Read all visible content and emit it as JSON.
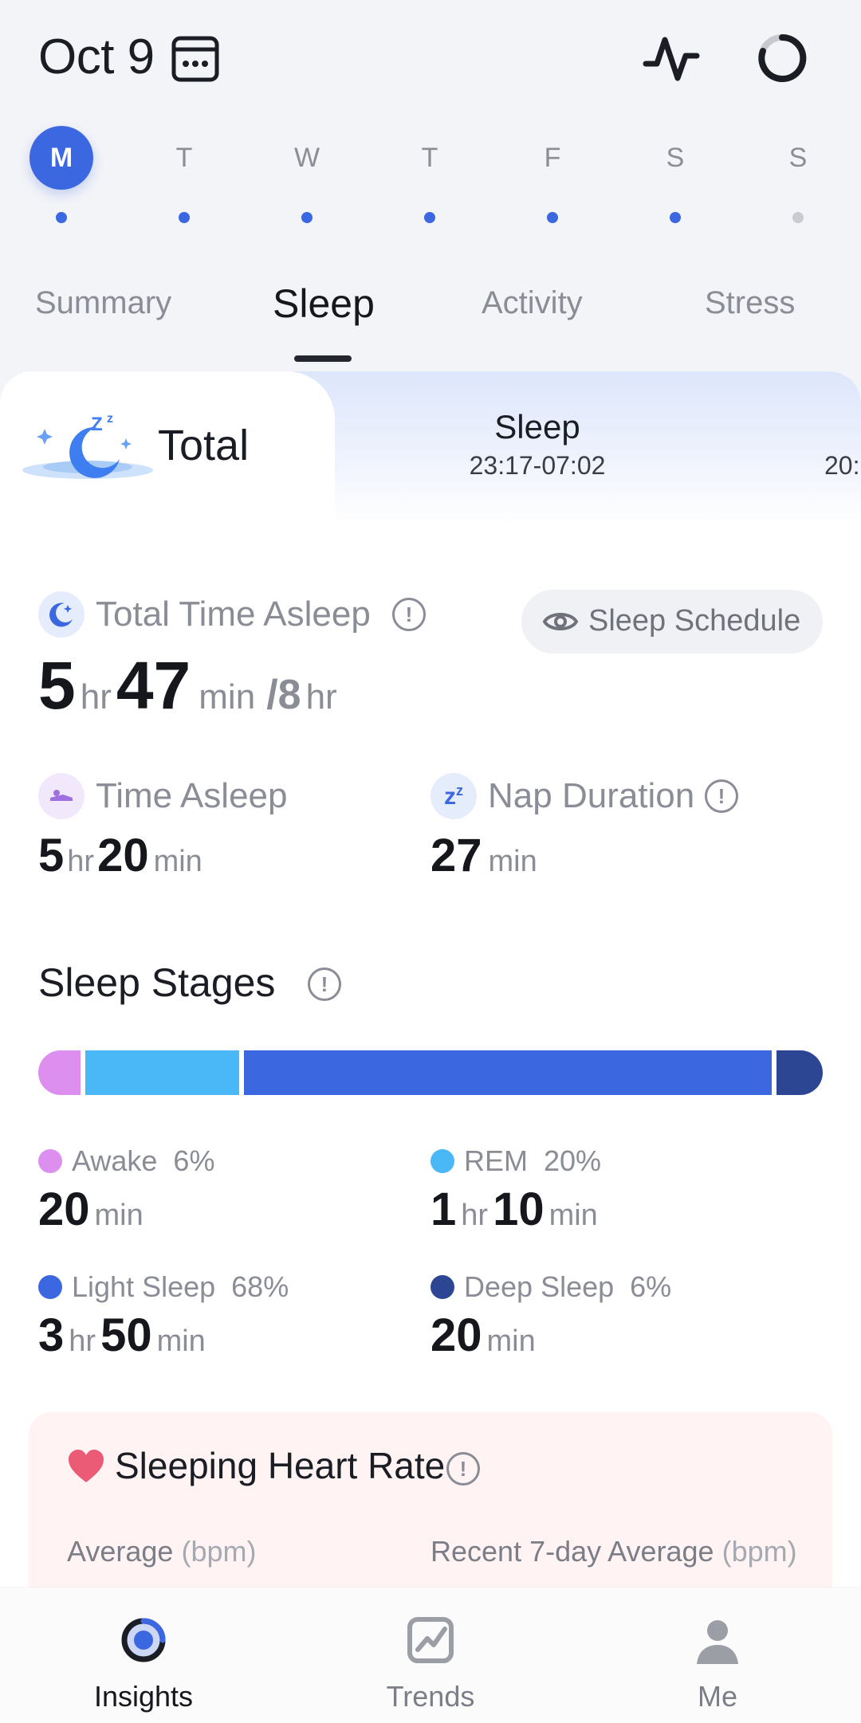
{
  "header": {
    "date": "Oct 9",
    "calendar_icon": "calendar-icon",
    "pulse_icon": "pulse-icon",
    "ring_icon": "ring-icon"
  },
  "week": {
    "days": [
      {
        "letter": "M",
        "active": true,
        "has_data": true
      },
      {
        "letter": "T",
        "active": false,
        "has_data": true
      },
      {
        "letter": "W",
        "active": false,
        "has_data": true
      },
      {
        "letter": "T",
        "active": false,
        "has_data": true
      },
      {
        "letter": "F",
        "active": false,
        "has_data": true
      },
      {
        "letter": "S",
        "active": false,
        "has_data": true
      },
      {
        "letter": "S",
        "active": false,
        "has_data": false
      }
    ]
  },
  "tabs": {
    "items": [
      "Summary",
      "Sleep",
      "Activity",
      "Stress"
    ],
    "active": "Sleep"
  },
  "subtabs": {
    "total_label": "Total",
    "sleep_label": "Sleep",
    "sleep_time": "23:17-07:02",
    "next_time": "20:"
  },
  "total_time_asleep": {
    "label": "Total Time Asleep",
    "hours": "5",
    "hours_unit": "hr",
    "minutes": "47",
    "minutes_unit": "min",
    "goal": "/8",
    "goal_unit": "hr",
    "schedule_button": "Sleep Schedule"
  },
  "time_asleep": {
    "label": "Time Asleep",
    "hours": "5",
    "hours_unit": "hr",
    "minutes": "20",
    "minutes_unit": "min"
  },
  "nap_duration": {
    "label": "Nap Duration",
    "minutes": "27",
    "minutes_unit": "min"
  },
  "sleep_stages": {
    "title": "Sleep Stages",
    "colors": {
      "awake": "#dd8ff0",
      "rem": "#4ab8f6",
      "light": "#3b67e0",
      "deep": "#2c4694"
    },
    "stages": [
      {
        "name": "Awake",
        "percent": "6%",
        "share": 0.055,
        "value_parts": [
          {
            "n": "20",
            "u": "min"
          }
        ]
      },
      {
        "name": "REM",
        "percent": "20%",
        "share": 0.2,
        "value_parts": [
          {
            "n": "1",
            "u": "hr"
          },
          {
            "n": "10",
            "u": "min"
          }
        ]
      },
      {
        "name": "Light Sleep",
        "percent": "68%",
        "share": 0.685,
        "value_parts": [
          {
            "n": "3",
            "u": "hr"
          },
          {
            "n": "50",
            "u": "min"
          }
        ]
      },
      {
        "name": "Deep Sleep",
        "percent": "6%",
        "share": 0.06,
        "value_parts": [
          {
            "n": "20",
            "u": "min"
          }
        ]
      }
    ]
  },
  "heart_rate": {
    "title": "Sleeping Heart Rate",
    "average_label": "Average",
    "average_unit": "(bpm)",
    "recent_label": "Recent 7-day Average",
    "recent_unit": "(bpm)"
  },
  "bottom_nav": {
    "items": [
      {
        "label": "Insights",
        "icon": "insights-icon",
        "active": true
      },
      {
        "label": "Trends",
        "icon": "trends-icon",
        "active": false
      },
      {
        "label": "Me",
        "icon": "profile-icon",
        "active": false
      }
    ]
  }
}
